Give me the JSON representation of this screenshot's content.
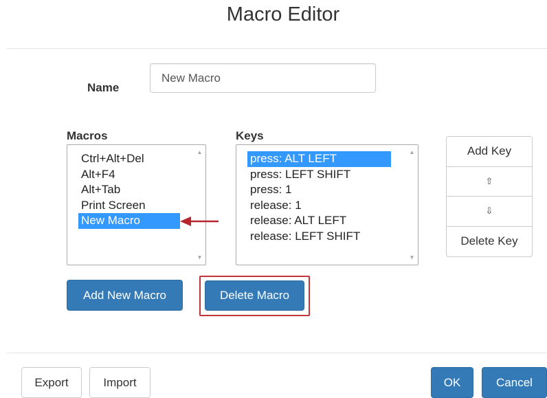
{
  "dialog": {
    "title": "Macro Editor"
  },
  "name_field": {
    "label": "Name",
    "value": "New Macro"
  },
  "macros": {
    "label": "Macros",
    "items": [
      "Ctrl+Alt+Del",
      "Alt+F4",
      "Alt+Tab",
      "Print Screen",
      "New Macro"
    ],
    "selected_index": 4
  },
  "keys": {
    "label": "Keys",
    "items": [
      "press: ALT LEFT",
      "press: LEFT SHIFT",
      "press: 1",
      "release: 1",
      "release: ALT LEFT",
      "release: LEFT SHIFT"
    ],
    "selected_index": 0
  },
  "key_buttons": {
    "add_key": "Add Key",
    "move_up": "⇧",
    "move_down": "⇩",
    "delete_key": "Delete Key"
  },
  "macro_buttons": {
    "add_new_macro": "Add New Macro",
    "delete_macro": "Delete Macro"
  },
  "footer": {
    "export": "Export",
    "import": "Import",
    "ok": "OK",
    "cancel": "Cancel"
  },
  "scrollbar": {
    "up_glyph": "▲",
    "down_glyph": "▼"
  },
  "colors": {
    "primary": "#337ab7",
    "selection": "#3399ff",
    "highlight": "#c0363a",
    "arrow": "#b5252b"
  },
  "icons": {
    "annotation": "red-arrow-icon"
  }
}
